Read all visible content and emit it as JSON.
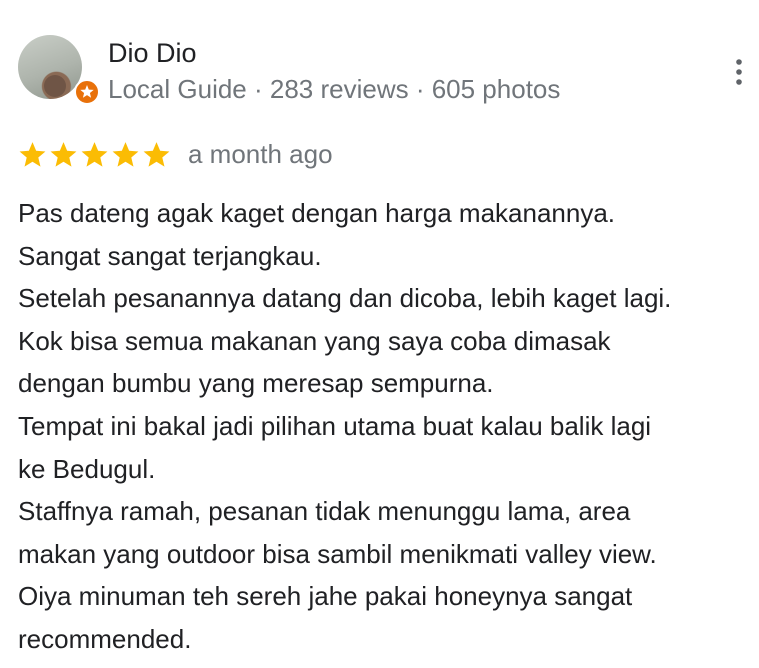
{
  "reviewer": {
    "name": "Dio Dio",
    "meta": "Local Guide · 283 reviews · 605 photos",
    "avatar_icon": "user-photo",
    "badge_icon": "local-guide-badge-icon",
    "badge_color": "#e8710a"
  },
  "more_icon": "more-vert-icon",
  "review": {
    "rating": 5,
    "rating_max": 5,
    "star_color": "#fbbc04",
    "date": "a month ago",
    "lines": [
      "Pas dateng agak kaget dengan harga makanannya.",
      "Sangat sangat terjangkau.",
      "Setelah pesanannya datang dan dicoba, lebih kaget lagi.",
      "Kok bisa semua makanan yang saya coba dimasak",
      "dengan bumbu yang meresap sempurna.",
      "Tempat ini bakal jadi pilihan utama buat kalau balik lagi",
      "ke Bedugul.",
      "Staffnya ramah, pesanan tidak menunggu lama, area",
      "makan yang outdoor bisa sambil menikmati valley view.",
      "Oiya minuman teh sereh jahe pakai honeynya sangat",
      "recommended."
    ]
  }
}
